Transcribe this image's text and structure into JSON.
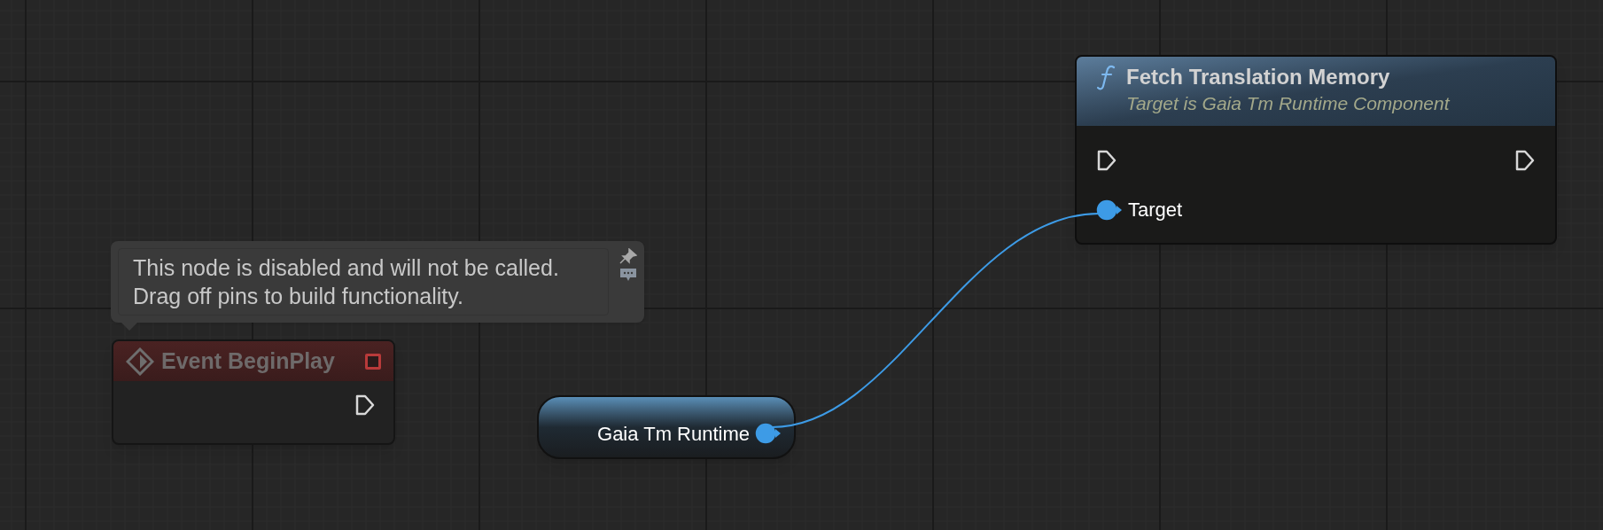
{
  "nodes": [
    {
      "kind": "event",
      "title": "Event BeginPlay",
      "disabled": true,
      "comment_lines": [
        "This node is disabled and will not be called.",
        "Drag off pins to build functionality."
      ],
      "pins": [
        {
          "kind": "exec",
          "connected": false
        }
      ]
    },
    {
      "kind": "variable",
      "title": "Gaia Tm Runtime",
      "pins": [
        {
          "kind": "object",
          "connected": true
        }
      ]
    },
    {
      "kind": "function",
      "title": "Fetch Translation Memory",
      "subtitle": "Target is Gaia Tm Runtime Component",
      "pins": [
        {
          "kind": "exec",
          "connected": false
        },
        {
          "kind": "exec",
          "connected": false
        },
        {
          "kind": "object",
          "label": "Target",
          "connected": true
        }
      ]
    }
  ]
}
